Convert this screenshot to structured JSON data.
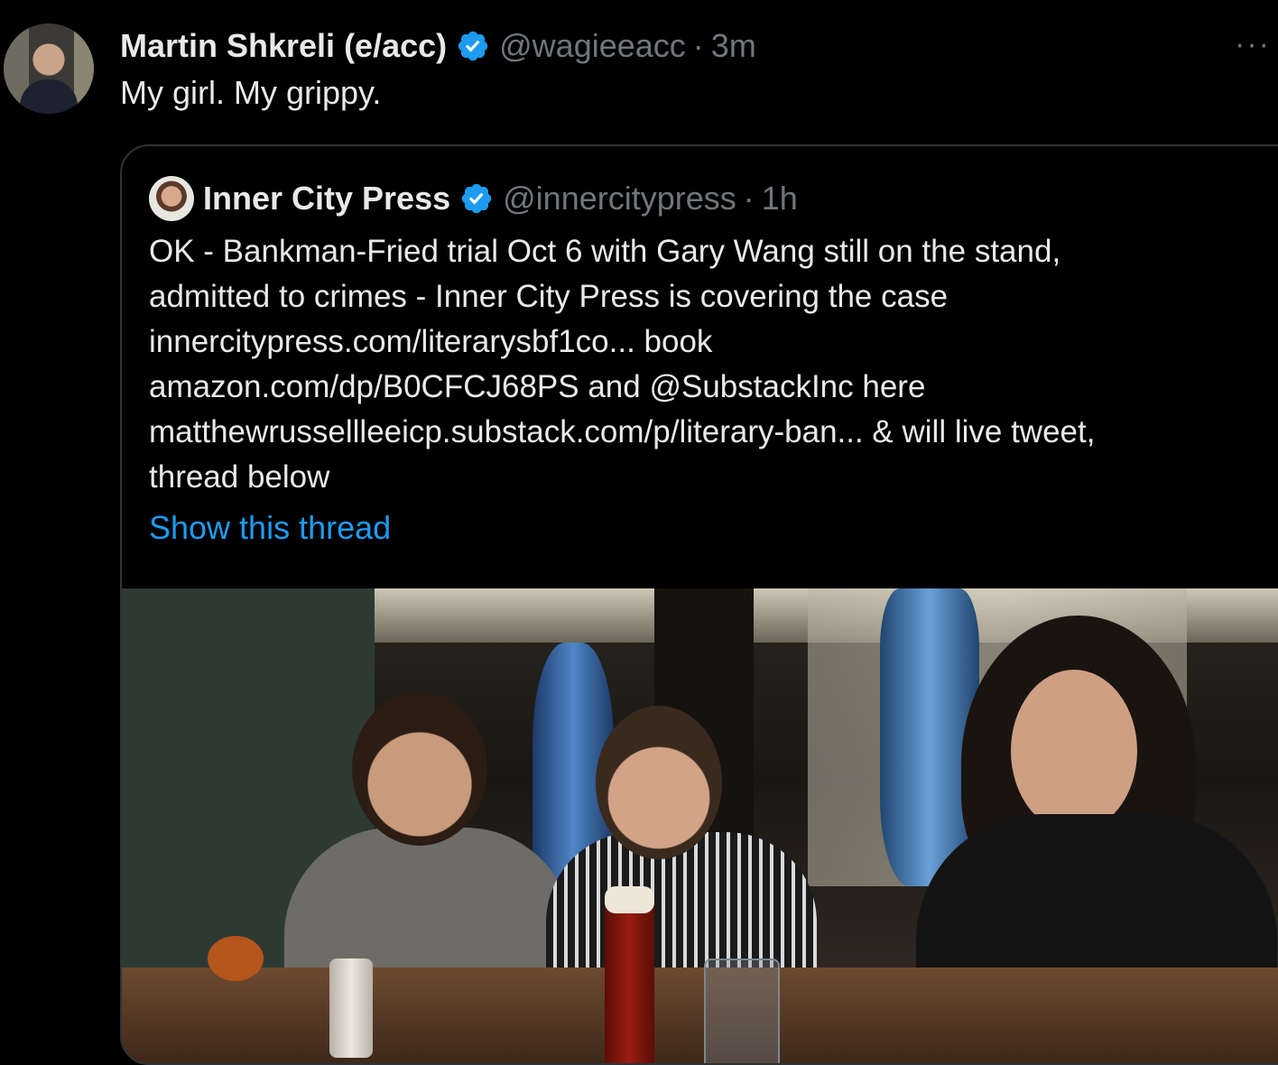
{
  "tweet": {
    "author_name": "Martin Shkreli (e/acc)",
    "handle": "@wagieeacc",
    "separator": "·",
    "time": "3m",
    "more": "···",
    "text": "My girl. My grippy."
  },
  "quoted": {
    "author_name": "Inner City Press",
    "handle": "@innercitypress",
    "separator": "·",
    "time": "1h",
    "lines": [
      "OK - Bankman-Fried trial Oct 6 with Gary Wang still on the stand,",
      "admitted to crimes - Inner City Press is covering the case",
      "innercitypress.com/literarysbf1co... book",
      "amazon.com/dp/B0CFCJ68PS and @SubstackInc here",
      "matthewrussellleeicp.substack.com/p/literary-ban... & will live tweet,",
      "thread below"
    ],
    "show_thread": "Show this thread"
  },
  "colors": {
    "background": "#000000",
    "text": "#e7e9ea",
    "muted": "#71767b",
    "link": "#1d9bf0",
    "verified": "#1d9bf0",
    "border": "#2f3336"
  },
  "icons": {
    "verified": "verified-badge-icon",
    "more": "more-icon"
  }
}
